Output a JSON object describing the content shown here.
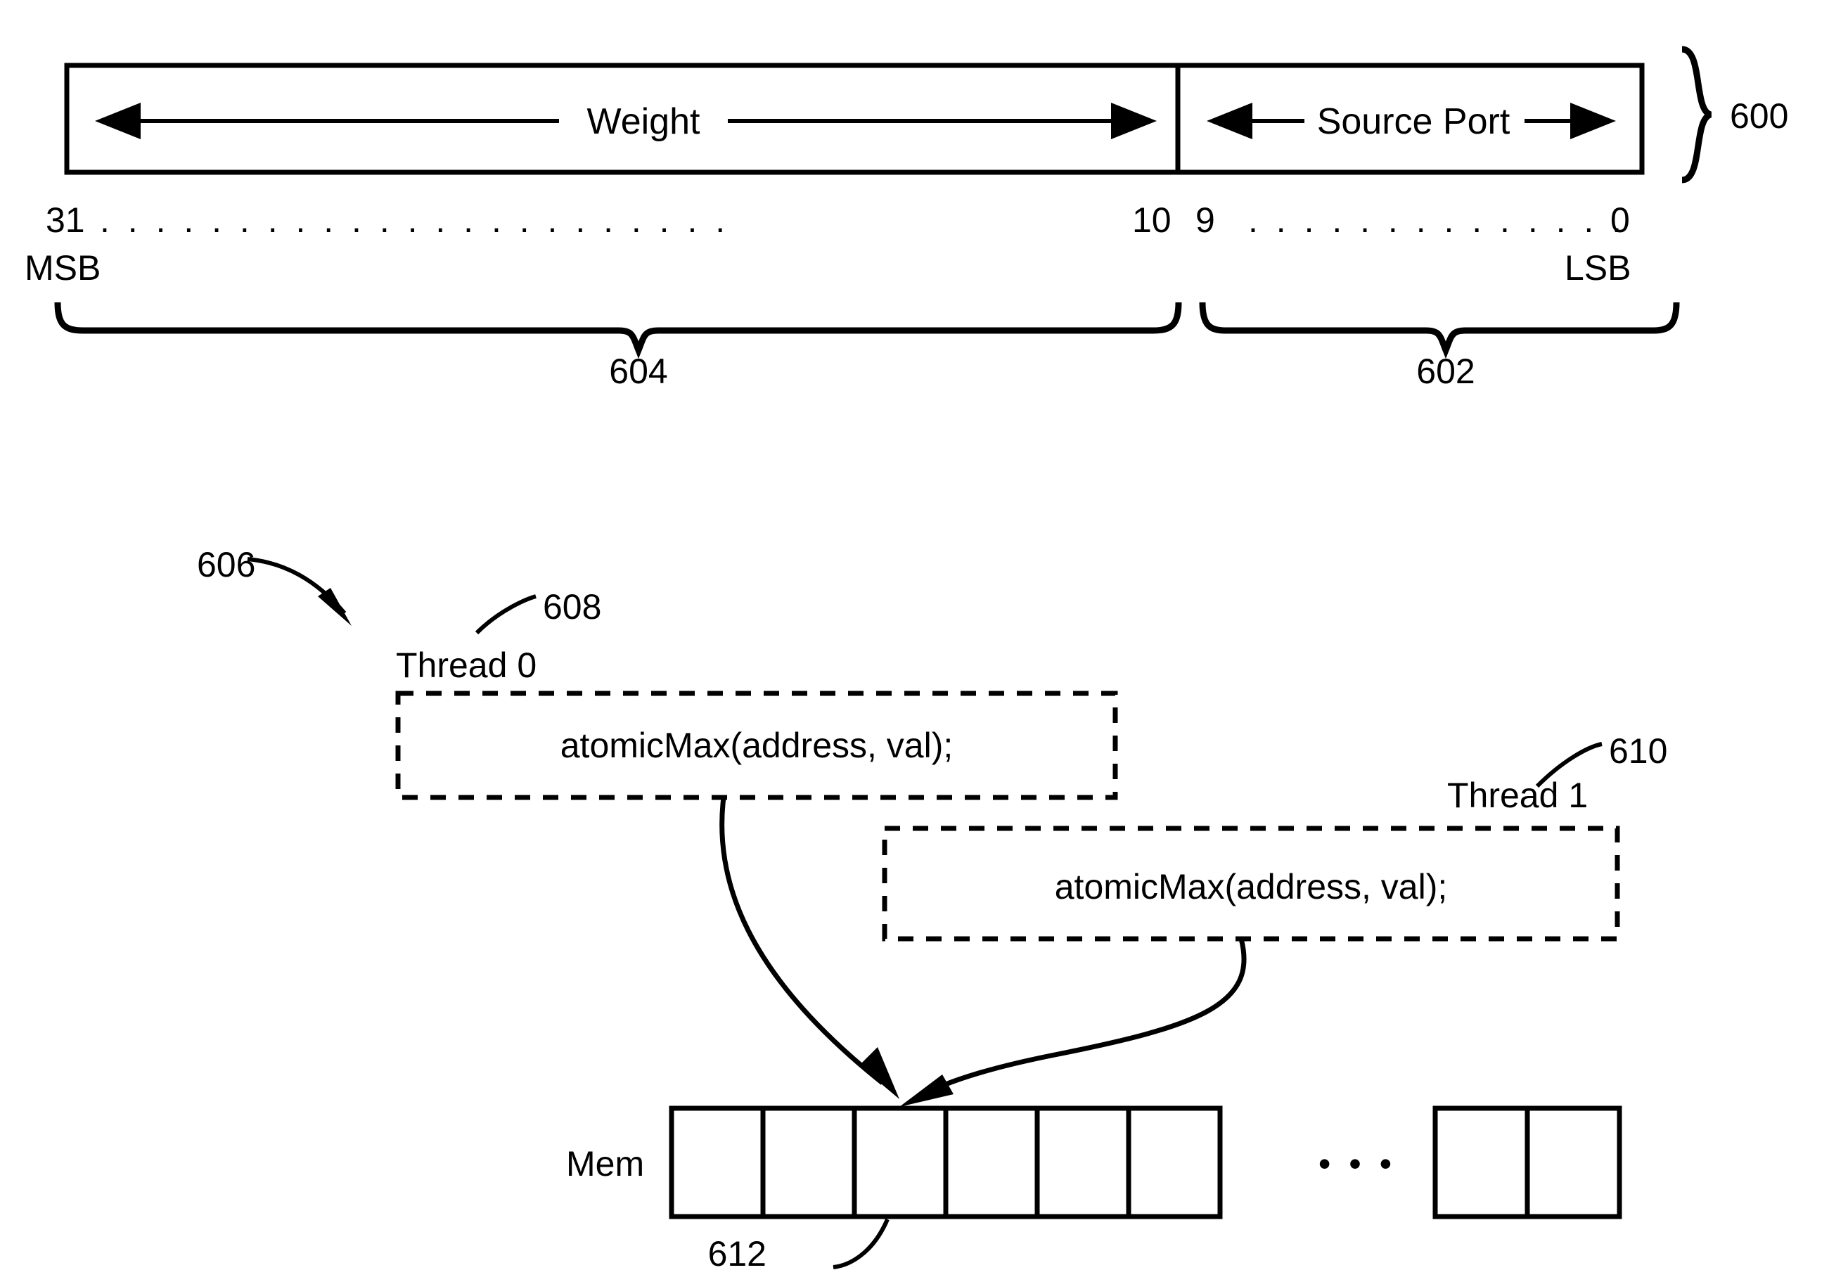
{
  "figure": {
    "title": "Patent figure: 32-bit word layout and atomicMax thread diagram",
    "ink_color": "#000000",
    "background_color": "#ffffff"
  },
  "bitfield_diagram": {
    "ref_label": "600",
    "fields": [
      {
        "name": "weight-field",
        "label": "Weight",
        "ref_label": "604",
        "msb": "31",
        "lsb": "10"
      },
      {
        "name": "source-port-field",
        "label": "Source Port",
        "ref_label": "602",
        "msb": "9",
        "lsb": "0"
      }
    ],
    "bit_labels": {
      "left_high": "31",
      "left_low": "10",
      "right_high": "9",
      "right_low": "0",
      "msb_caption": "MSB",
      "lsb_caption": "LSB",
      "dots_left": ". . . . . . . . . . . . . . . . . . . . . . .",
      "dots_right": ". . . . . . . . . . . . . ."
    }
  },
  "thread_diagram": {
    "ref_label": "606",
    "threads": [
      {
        "name": "thread-0",
        "title": "Thread 0",
        "ref_label": "608",
        "code": "atomicMax(address, val);"
      },
      {
        "name": "thread-1",
        "title": "Thread 1",
        "ref_label": "610",
        "code": "atomicMax(address, val);"
      }
    ],
    "memory": {
      "label": "Mem",
      "ref_label": "612",
      "ellipsis": "• • •",
      "left_group_cells": 6,
      "right_group_cells": 2,
      "target_cell_index": 2
    }
  }
}
